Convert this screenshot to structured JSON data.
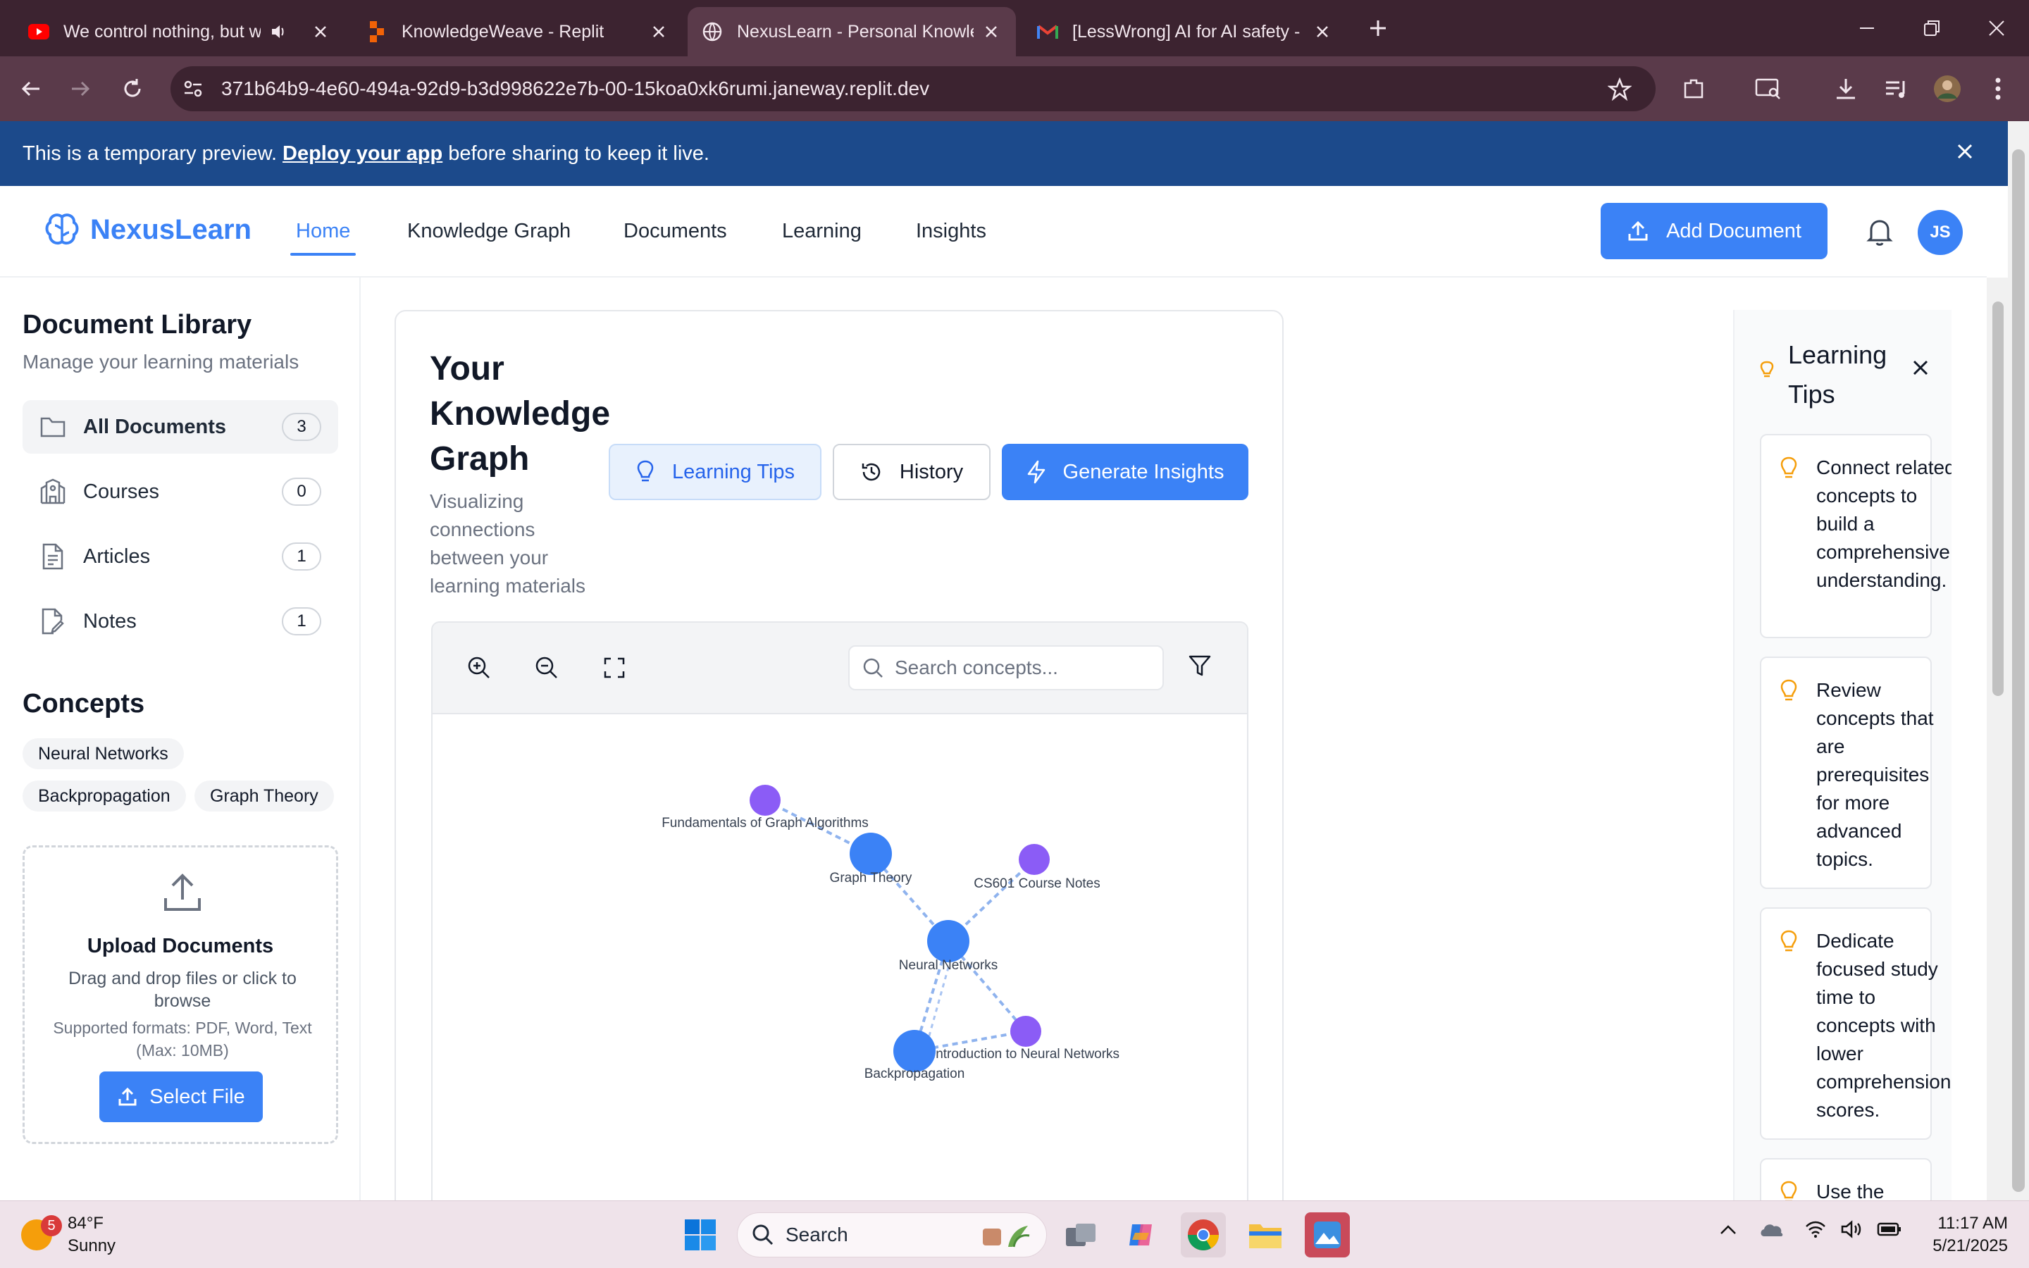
{
  "browser": {
    "tabs": [
      {
        "title": "We control nothing, but we",
        "icon": "youtube-icon"
      },
      {
        "title": "KnowledgeWeave - Replit",
        "icon": "replit-icon"
      },
      {
        "title": "NexusLearn - Personal Knowled",
        "icon": "globe-icon"
      },
      {
        "title": "[LessWrong] AI for AI safety - m",
        "icon": "gmail-icon"
      }
    ],
    "url": "371b64b9-4e60-494a-92d9-b3d998622e7b-00-15koa0xk6rumi.janeway.replit.dev"
  },
  "banner": {
    "text_before": "This is a temporary preview.",
    "link": "Deploy your app",
    "text_after": "before sharing to keep it live."
  },
  "header": {
    "app_name": "NexusLearn",
    "nav": [
      "Home",
      "Knowledge Graph",
      "Documents",
      "Learning",
      "Insights"
    ],
    "active_nav": "Home",
    "add_document": "Add Document",
    "avatar_initials": "JS",
    "accent_color": "#3b82f6"
  },
  "sidebar": {
    "library_title": "Document Library",
    "library_subtitle": "Manage your learning materials",
    "categories": [
      {
        "label": "All Documents",
        "count": "3",
        "icon": "folder-icon"
      },
      {
        "label": "Courses",
        "count": "0",
        "icon": "school-icon"
      },
      {
        "label": "Articles",
        "count": "1",
        "icon": "file-text-icon"
      },
      {
        "label": "Notes",
        "count": "1",
        "icon": "file-edit-icon"
      }
    ],
    "concepts_title": "Concepts",
    "concepts": [
      "Neural Networks",
      "Backpropagation",
      "Graph Theory"
    ],
    "upload": {
      "title": "Upload Documents",
      "description": "Drag and drop files or click to browse",
      "formats": "Supported formats: PDF, Word, Text (Max: 10MB)",
      "button": "Select File"
    }
  },
  "main": {
    "title": "Your Knowledge Graph",
    "subtitle": "Visualizing connections between your learning materials",
    "buttons": {
      "learning_tips": "Learning Tips",
      "history": "History",
      "generate_insights": "Generate Insights"
    },
    "search_placeholder": "Search concepts...",
    "graph": {
      "nodes": [
        {
          "label": "Fundamentals of Graph Algorithms",
          "kind": "document"
        },
        {
          "label": "Graph Theory",
          "kind": "concept"
        },
        {
          "label": "CS601 Course Notes",
          "kind": "document"
        },
        {
          "label": "Neural Networks",
          "kind": "concept"
        },
        {
          "label": "Introduction to Neural Networks",
          "kind": "document"
        },
        {
          "label": "Backpropagation",
          "kind": "concept"
        }
      ],
      "edges": [
        [
          "Fundamentals of Graph Algorithms",
          "Graph Theory"
        ],
        [
          "Graph Theory",
          "Neural Networks"
        ],
        [
          "CS601 Course Notes",
          "Neural Networks"
        ],
        [
          "Neural Networks",
          "Introduction to Neural Networks"
        ],
        [
          "Neural Networks",
          "Backpropagation"
        ],
        [
          "Introduction to Neural Networks",
          "Backpropagation"
        ]
      ],
      "concept_color": "#3b82f6",
      "document_color": "#8b5cf6"
    }
  },
  "tips_panel": {
    "title": "Learning Tips",
    "tips": [
      "Connect related concepts to build a comprehensive understanding.",
      "Review concepts that are prerequisites for more advanced topics.",
      "Dedicate focused study time to concepts with lower comprehension scores.",
      "Use the"
    ]
  },
  "taskbar": {
    "weather_badge": "5",
    "temperature": "84°F",
    "condition": "Sunny",
    "search_label": "Search",
    "time": "11:17 AM",
    "date": "5/21/2025"
  }
}
